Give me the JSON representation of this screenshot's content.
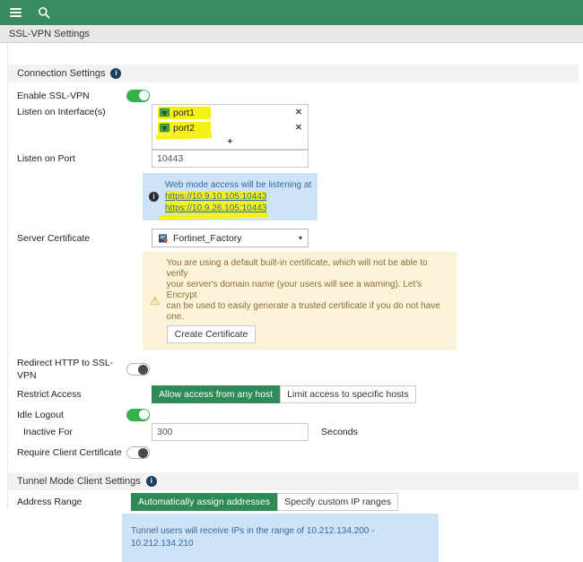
{
  "breadcrumb": {
    "title": "SSL-VPN Settings"
  },
  "icons": {
    "menu": "hamburger-menu",
    "search": "magnifier",
    "info": "i",
    "warning": "⚠",
    "remove": "✕",
    "add": "+",
    "caret": "▾",
    "interface": "ethernet-port",
    "certificate": "certificate-badge"
  },
  "colors": {
    "topbar_green": "#398b5f",
    "accent_green": "#2e8b57",
    "toggle_on_green": "#35b24e",
    "highlight_yellow": "#f5f118",
    "info_box_blue": "#cfe3f8",
    "warning_box_yellow": "#fbf3d8",
    "link_blue": "#2e6da4"
  },
  "connection": {
    "title": "Connection Settings",
    "enable": {
      "label": "Enable SSL-VPN",
      "enabled": true
    },
    "interfaces": {
      "label": "Listen on Interface(s)",
      "items": [
        {
          "name": "port1"
        },
        {
          "name": "port2"
        }
      ]
    },
    "port": {
      "label": "Listen on Port",
      "value": "10443"
    },
    "web_mode": {
      "text": "Web mode access will be listening at",
      "links": [
        "https://10.9.10.105:10443",
        "https://10.9.26.105:10443"
      ]
    },
    "certificate": {
      "label": "Server Certificate",
      "value": "Fortinet_Factory"
    },
    "cert_warning": {
      "text": "You are using a default built-in certificate, which will not be able to verify\nyour server's domain name (your users will see a warning). Let's Encrypt\ncan be used to easily generate a trusted certificate if you do not have\none.",
      "button": "Create Certificate"
    },
    "redirect": {
      "label": "Redirect HTTP to SSL-VPN",
      "enabled": false
    },
    "restrict": {
      "label": "Restrict Access",
      "options": [
        "Allow access from any host",
        "Limit access to specific hosts"
      ],
      "selected": 0
    },
    "idle": {
      "label": "Idle Logout",
      "enabled": true
    },
    "inactive": {
      "label": "Inactive For",
      "value": "300",
      "unit": "Seconds"
    },
    "client_cert": {
      "label": "Require Client Certificate",
      "enabled": false
    }
  },
  "tunnel": {
    "title": "Tunnel Mode Client Settings",
    "address_range": {
      "label": "Address Range",
      "options": [
        "Automatically assign addresses",
        "Specify custom IP ranges"
      ],
      "selected": 0
    },
    "info": "Tunnel users will receive IPs in the range of 10.212.134.200 -\n10.212.134.210"
  }
}
